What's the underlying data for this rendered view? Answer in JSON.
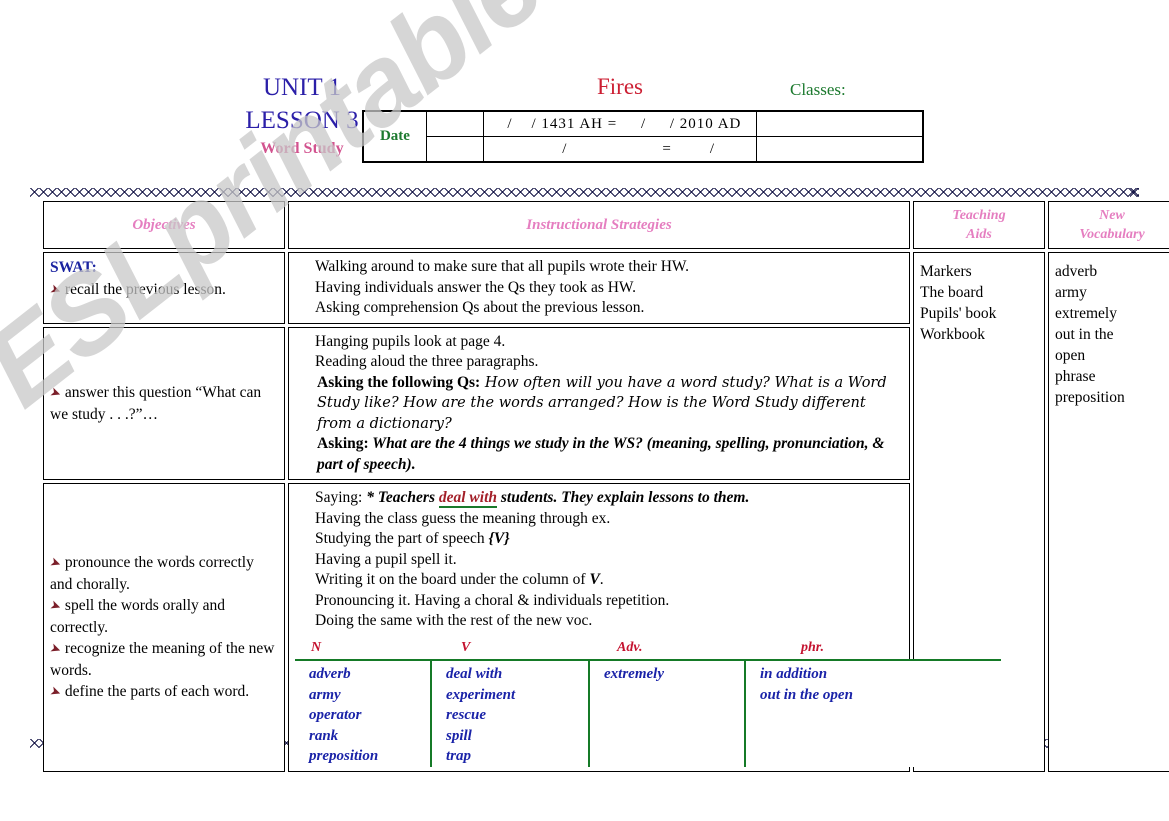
{
  "watermark": "ESLprintables.com",
  "header": {
    "unit": "UNIT 1",
    "lesson": "LESSON 3",
    "section": "Word Study",
    "subject": "Fires",
    "classes_label": "Classes:",
    "date_table": {
      "date_label": "Date",
      "blank_1": "",
      "hijri_gregorian": "  /    / 1431 AH =     /     / 2010 AD",
      "right_1": "",
      "blank_2": "",
      "hijri_gregorian_2": "        /                    =        /",
      "right_2": ""
    }
  },
  "table": {
    "columns": {
      "objectives": "Objectives",
      "instructional_strategies": "Instructional Strategies",
      "teaching_aids_line1": "Teaching",
      "teaching_aids_line2": "Aids",
      "new_vocabulary_line1": "New",
      "new_vocabulary_line2": "Vocabulary"
    },
    "rows": [
      {
        "objectives": {
          "heading": "SWAT:",
          "items": [
            "recall the previous lesson."
          ]
        },
        "strategies": [
          "Walking around to make sure that all pupils wrote their HW.",
          "Having individuals answer the Qs they took as HW.",
          "Asking comprehension Qs about the previous lesson."
        ]
      },
      {
        "objectives": {
          "items": [
            "answer this question “What can we study . . .?”…"
          ]
        },
        "strategies_rich": {
          "line1": "Hanging pupils look at page 4.",
          "line2": "Reading aloud the three paragraphs.",
          "line3_bold": "Asking the following Qs:",
          "line3_italic": " How often will you have a word study? What is a Word Study like? How are the words arranged? How is the Word Study different from a dictionary?",
          "line4_bold": "Asking:",
          "line4_emph": " What are the 4 things we study in the WS? (meaning, spelling, pronunciation, & part of speech)."
        }
      },
      {
        "objectives": {
          "items": [
            "pronounce the words correctly and chorally.",
            "spell the words orally and correctly.",
            "recognize the meaning of the new words.",
            "define the parts of each word."
          ]
        },
        "strategies_rich": {
          "saying_label": "Saying:",
          "saying_star": " * ",
          "saying_pre": "Teachers ",
          "saying_highlight": "deal with",
          "saying_post": " students. They explain lessons to them.",
          "line2": "Having the class guess the meaning through ex.",
          "line3_pre": "Studying the  part of speech ",
          "line3_brace": "{V}",
          "line4": "Having a pupil spell it.",
          "line5_pre": "Writing it on the board under the column of ",
          "line5_emph": "V",
          "line5_post": ".",
          "line6": "Pronouncing it. Having a choral & individuals repetition.",
          "line7": "Doing the same with the rest of the new voc."
        },
        "word_study": {
          "headers": [
            "N",
            "V",
            "Adv.",
            "phr."
          ],
          "columns": [
            [
              "adverb",
              "army",
              "operator",
              "rank",
              "preposition"
            ],
            [
              "deal with",
              "experiment",
              "rescue",
              "spill",
              "trap"
            ],
            [
              "extremely"
            ],
            [
              "in addition",
              "out in the open"
            ]
          ]
        }
      }
    ],
    "teaching_aids": [
      "Markers",
      "The board",
      "Pupils' book",
      "Workbook"
    ],
    "new_vocabulary": [
      "adverb",
      "army",
      "extremely",
      "out in the",
      "open",
      "phrase",
      "preposition"
    ]
  },
  "icons": {
    "bullet": "➤"
  }
}
